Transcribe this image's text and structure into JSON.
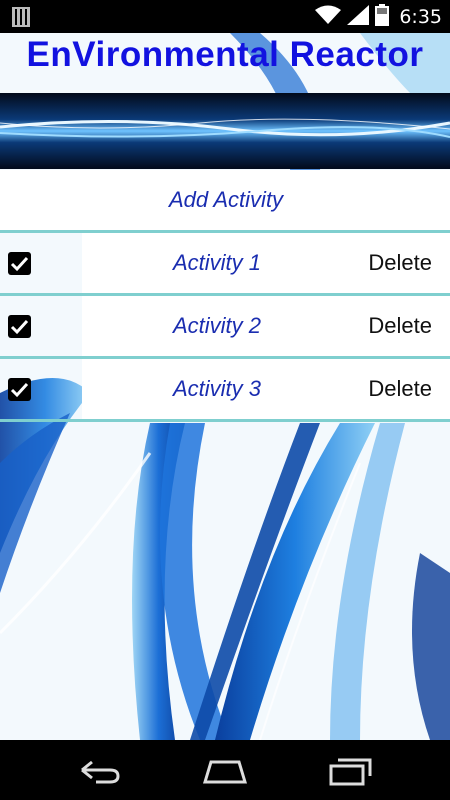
{
  "status_bar": {
    "time": "6:35",
    "icons": [
      "notification-icon",
      "wifi-icon",
      "signal-icon",
      "battery-icon"
    ]
  },
  "app": {
    "title": "EnVironmental Reactor",
    "add_label": "Add Activity",
    "activities": [
      {
        "label": "Activity 1",
        "checked": true,
        "delete_label": "Delete"
      },
      {
        "label": "Activity 2",
        "checked": true,
        "delete_label": "Delete"
      },
      {
        "label": "Activity 3",
        "checked": true,
        "delete_label": "Delete"
      }
    ]
  },
  "nav_bar": {
    "icons": [
      "back-icon",
      "home-icon",
      "recents-icon"
    ]
  },
  "colors": {
    "title": "#1212e0",
    "activity_text": "#1a2db0",
    "divider": "#7fcfcf"
  }
}
